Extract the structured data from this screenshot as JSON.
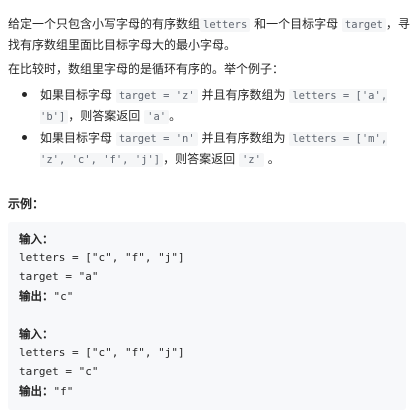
{
  "description": {
    "p1_part1": "给定一个只包含小写字母的有序数组",
    "p1_code1": "letters",
    "p1_part2": " 和一个目标字母 ",
    "p1_code2": "target",
    "p1_part3": "，寻找有序数组里面比目标字母大的最小字母。",
    "p2": "在比较时，数组里字母的是循环有序的。举个例子："
  },
  "bullets": [
    {
      "t1": "如果目标字母 ",
      "c1": "target = 'z'",
      "t2": " 并且有序数组为 ",
      "c2": "letters = ['a', 'b']",
      "t3": "，则答案返回 ",
      "c3": "'a'",
      "t4": "。"
    },
    {
      "t1": "如果目标字母 ",
      "c1": "target = 'n'",
      "t2": " 并且有序数组为 ",
      "c2": "letters = ['m', 'z', 'c', 'f', 'j']",
      "t3": "，则答案返回 ",
      "c3": "'z'",
      "t4": " 。"
    }
  ],
  "example": {
    "title": "示例：",
    "cases": [
      {
        "input_label": "输入：",
        "line1": "letters = [\"c\", \"f\", \"j\"]",
        "line2": "target = \"a\"",
        "output_label": "输出：",
        "output_value": "\"c\""
      },
      {
        "input_label": "输入：",
        "line1": "letters = [\"c\", \"f\", \"j\"]",
        "line2": "target = \"c\"",
        "output_label": "输出：",
        "output_value": "\"f\""
      }
    ]
  }
}
